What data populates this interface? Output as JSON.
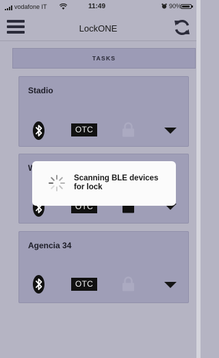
{
  "status_bar": {
    "carrier": "vodafone IT",
    "time": "11:49",
    "battery": "90%"
  },
  "nav": {
    "title": "LockONE"
  },
  "tasks_label": "TASKS",
  "devices": [
    {
      "name": "Stadio",
      "otc_label": "OTC",
      "lock_state": "disabled"
    },
    {
      "name": "W",
      "otc_label": "OTC",
      "lock_state": "active"
    },
    {
      "name": "Agencia 34",
      "otc_label": "OTC",
      "lock_state": "disabled"
    }
  ],
  "modal": {
    "message_line1": "Scanning BLE devices",
    "message_line2": "for lock"
  },
  "colors": {
    "background": "#b5b4c3",
    "card": "#9f9eb7",
    "otc": "#111111"
  }
}
